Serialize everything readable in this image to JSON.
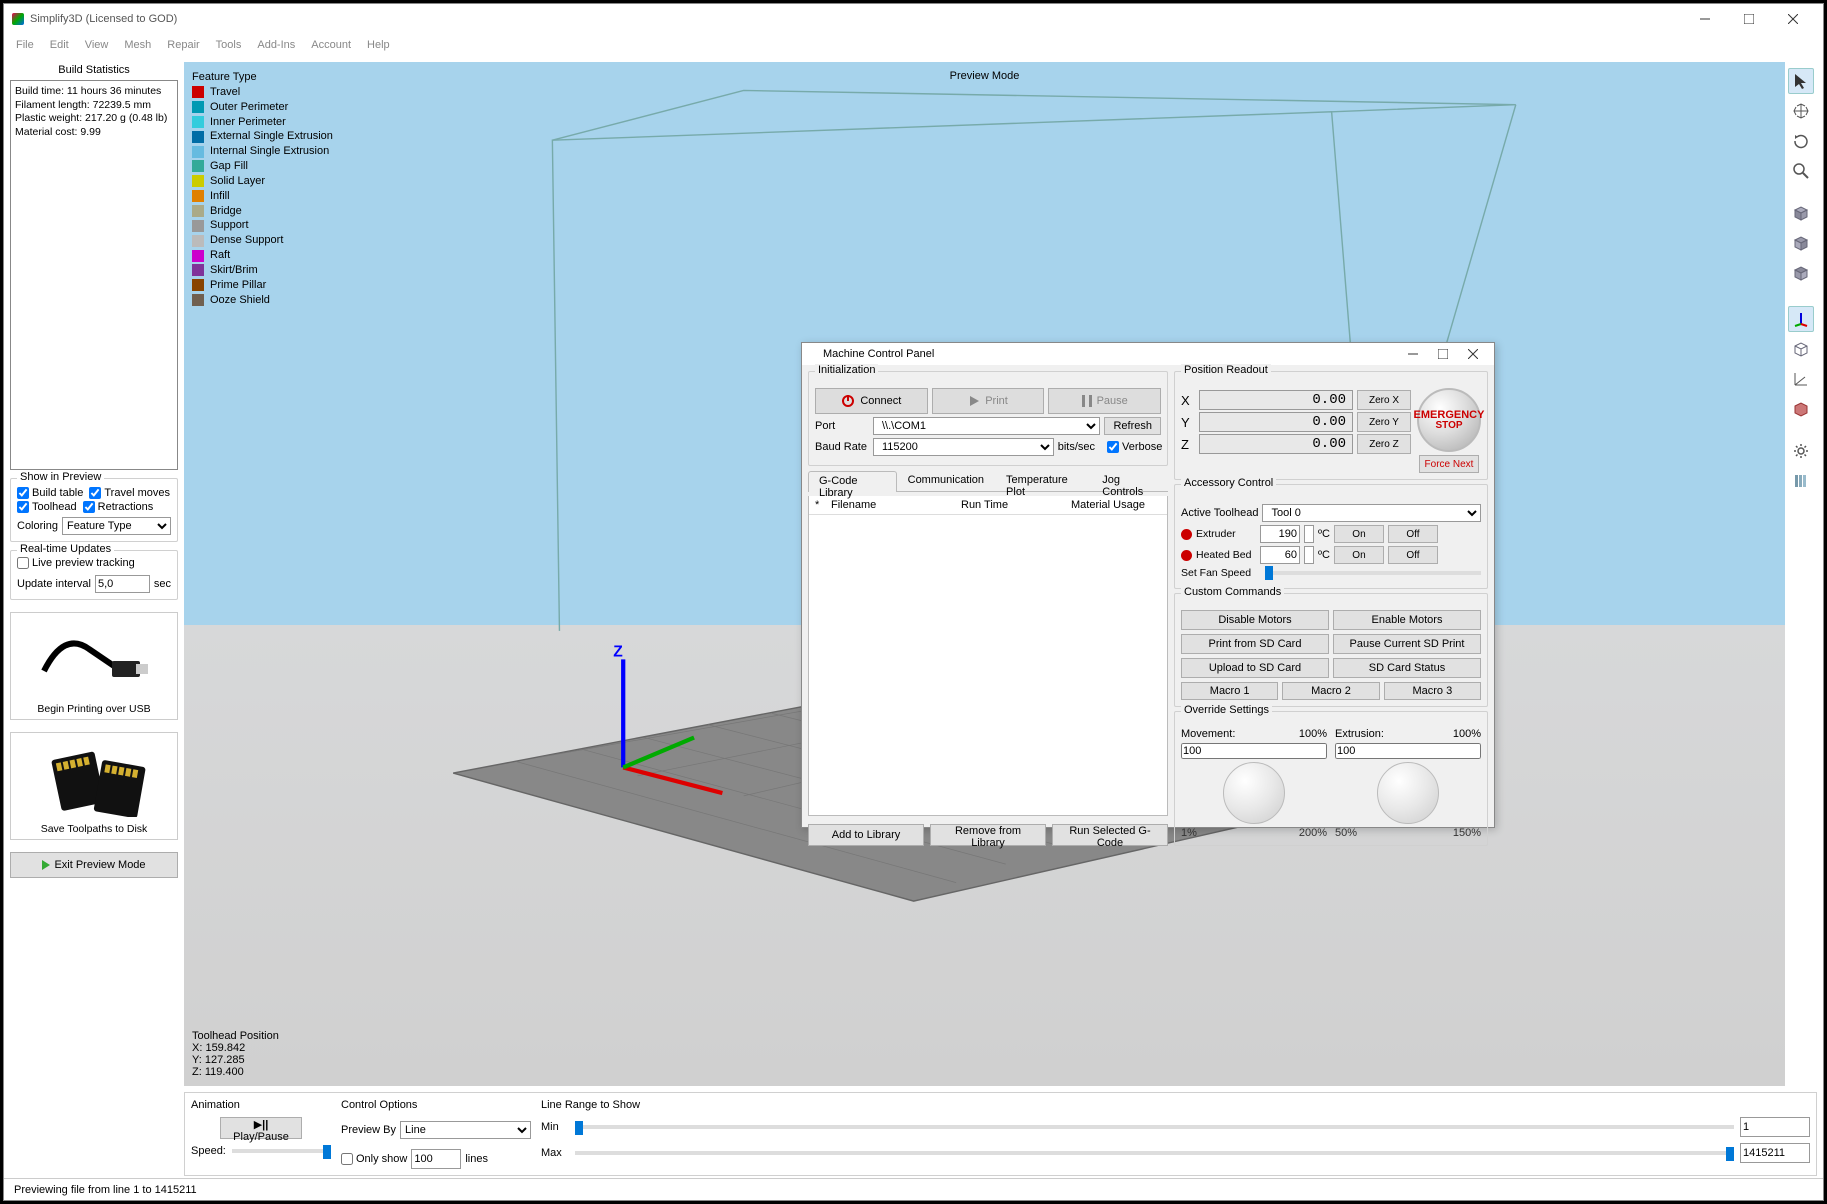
{
  "window": {
    "title": "Simplify3D (Licensed to GOD)"
  },
  "menubar": [
    "File",
    "Edit",
    "View",
    "Mesh",
    "Repair",
    "Tools",
    "Add-Ins",
    "Account",
    "Help"
  ],
  "build_stats": {
    "title": "Build Statistics",
    "lines": {
      "build_time": "Build time: 11 hours 36 minutes",
      "filament": "Filament length: 72239.5 mm",
      "weight": "Plastic weight: 217.20 g (0.48 lb)",
      "cost": "Material cost: 9.99"
    }
  },
  "show_in_preview": {
    "title": "Show in Preview",
    "build_table": "Build table",
    "travel_moves": "Travel moves",
    "toolhead": "Toolhead",
    "retractions": "Retractions",
    "coloring_label": "Coloring",
    "coloring_value": "Feature Type"
  },
  "realtime": {
    "title": "Real-time Updates",
    "live": "Live preview tracking",
    "interval_label": "Update interval",
    "interval_value": "5,0",
    "interval_unit": "sec"
  },
  "cards": {
    "usb": "Begin Printing over USB",
    "disk": "Save Toolpaths to Disk"
  },
  "exit_btn": "Exit Preview Mode",
  "viewport": {
    "feature_header": "Feature Type",
    "preview_mode": "Preview Mode",
    "features": [
      {
        "name": "Travel",
        "color": "#cc0000"
      },
      {
        "name": "Outer Perimeter",
        "color": "#0099b3"
      },
      {
        "name": "Inner Perimeter",
        "color": "#33ccdd"
      },
      {
        "name": "External Single Extrusion",
        "color": "#006da6"
      },
      {
        "name": "Internal Single Extrusion",
        "color": "#66bbe0"
      },
      {
        "name": "Gap Fill",
        "color": "#33aa99"
      },
      {
        "name": "Solid Layer",
        "color": "#cccc00"
      },
      {
        "name": "Infill",
        "color": "#e08000"
      },
      {
        "name": "Bridge",
        "color": "#aaaa88"
      },
      {
        "name": "Support",
        "color": "#999999"
      },
      {
        "name": "Dense Support",
        "color": "#bbbbbb"
      },
      {
        "name": "Raft",
        "color": "#cc00cc"
      },
      {
        "name": "Skirt/Brim",
        "color": "#803399"
      },
      {
        "name": "Prime Pillar",
        "color": "#884400"
      },
      {
        "name": "Ooze Shield",
        "color": "#706050"
      }
    ],
    "toolhead_pos": {
      "title": "Toolhead Position",
      "x": "X: 159.842",
      "y": "Y: 127.285",
      "z": "Z: 119.400"
    }
  },
  "bottom": {
    "animation": "Animation",
    "play_pause": "Play/Pause",
    "speed": "Speed:",
    "control_options": "Control Options",
    "preview_by": "Preview By",
    "preview_by_val": "Line",
    "only_show": "Only show",
    "only_show_val": "100",
    "only_show_unit": "lines",
    "line_range": "Line Range to Show",
    "min": "Min",
    "max": "Max",
    "min_val": "1",
    "max_val": "1415211"
  },
  "statusbar": "Previewing file from line 1 to 1415211",
  "mcp": {
    "title": "Machine Control Panel",
    "init": {
      "title": "Initialization",
      "connect": "Connect",
      "print": "Print",
      "pause": "Pause",
      "port_label": "Port",
      "port_val": "\\\\.\\COM1",
      "refresh": "Refresh",
      "baud_label": "Baud Rate",
      "baud_val": "115200",
      "baud_unit": "bits/sec",
      "verbose": "Verbose"
    },
    "tabs": [
      "G-Code Library",
      "Communication",
      "Temperature Plot",
      "Jog Controls"
    ],
    "gcode": {
      "col_star": "*",
      "col_file": "Filename",
      "col_run": "Run Time",
      "col_mat": "Material Usage",
      "add": "Add to Library",
      "remove": "Remove from Library",
      "run": "Run Selected G-Code"
    },
    "pos": {
      "title": "Position Readout",
      "x": "X",
      "y": "Y",
      "z": "Z",
      "val": "0.00",
      "zero_x": "Zero X",
      "zero_y": "Zero Y",
      "zero_z": "Zero Z",
      "estop_top": "EMERGENCY",
      "estop_bot": "STOP",
      "force": "Force Next"
    },
    "acc": {
      "title": "Accessory Control",
      "tool_label": "Active Toolhead",
      "tool_val": "Tool 0",
      "extruder": "Extruder",
      "extruder_val": "190",
      "bed": "Heated Bed",
      "bed_val": "60",
      "unit": "ºC",
      "on": "On",
      "off": "Off",
      "fan_label": "Set Fan Speed"
    },
    "cust": {
      "title": "Custom Commands",
      "b1": "Disable Motors",
      "b2": "Enable Motors",
      "b3": "Print from SD Card",
      "b4": "Pause Current SD Print",
      "b5": "Upload to SD Card",
      "b6": "SD Card Status",
      "m1": "Macro 1",
      "m2": "Macro 2",
      "m3": "Macro 3"
    },
    "ovr": {
      "title": "Override Settings",
      "movement": "Movement:",
      "extrusion": "Extrusion:",
      "m_val": "100",
      "m_pct": "100%",
      "e_val": "100",
      "e_pct": "100%",
      "m_lo": "1%",
      "m_hi": "200%",
      "e_lo": "50%",
      "e_hi": "150%"
    }
  }
}
